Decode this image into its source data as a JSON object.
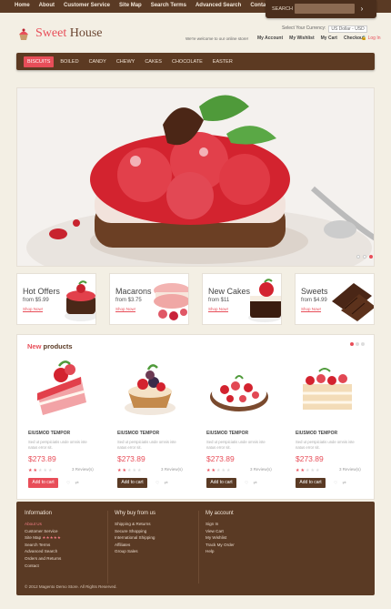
{
  "topnav": [
    "Home",
    "About",
    "Customer Service",
    "Site Map",
    "Search Terms",
    "Advanced Search",
    "Contacts"
  ],
  "search": {
    "label": "SEARCH",
    "placeholder": ""
  },
  "logo": {
    "word1": "Sweet",
    "word2": "House"
  },
  "currency": {
    "label": "Select Your Currency:",
    "value": "US Dollar - USD"
  },
  "welcome": "We're welcome to our online store!",
  "account_links": [
    "My Account",
    "My Wishlist",
    "My Cart",
    "Checkout"
  ],
  "login": "Log In",
  "menu": [
    "BISCUITS",
    "BOILED",
    "CANDY",
    "CHEWY",
    "CAKES",
    "CHOCOLATE",
    "EASTER"
  ],
  "hero": {
    "slides": 3,
    "active": 0
  },
  "banners": [
    {
      "title": "Hot Offers",
      "price": "from $5.99",
      "link": "Shop Now!"
    },
    {
      "title": "Macarons",
      "price": "from $3.75",
      "link": "Shop Now!"
    },
    {
      "title": "New Cakes",
      "price": "from $11",
      "link": "Shop Now!"
    },
    {
      "title": "Sweets",
      "price": "from $4.99",
      "link": "Shop Now!"
    }
  ],
  "new_products": {
    "title_accent": "New",
    "title_rest": " products",
    "items": [
      {
        "name": "EIUSMOD TEMPOR",
        "desc": "Sed ut perspiciatis unde omnis iste natus error sit.",
        "price": "$273.89",
        "reviews": "3 Review(s)",
        "button": "Add to cart",
        "rating": 2
      },
      {
        "name": "EIUSMOD TEMPOR",
        "desc": "Sed ut perspiciatis unde omnis iste natus error sit.",
        "price": "$273.89",
        "reviews": "3 Review(s)",
        "button": "Add to cart",
        "rating": 2
      },
      {
        "name": "EIUSMOD TEMPOR",
        "desc": "Sed ut perspiciatis unde omnis iste natus error sit.",
        "price": "$273.89",
        "reviews": "3 Review(s)",
        "button": "Add to cart",
        "rating": 2
      },
      {
        "name": "EIUSMOD TEMPOR",
        "desc": "Sed ut perspiciatis unde omnis iste natus error sit.",
        "price": "$273.89",
        "reviews": "3 Review(s)",
        "button": "Add to cart",
        "rating": 2
      }
    ]
  },
  "footer": {
    "col1": {
      "title": "Information",
      "links": [
        "About Us",
        "Customer Service",
        "Site Map",
        "Search Terms",
        "Advanced Search",
        "Orders and Returns",
        "Contact"
      ]
    },
    "col2": {
      "title": "Why buy from us",
      "links": [
        "Shipping & Returns",
        "Secure Shopping",
        "International Shipping",
        "Affiliates",
        "Group Sales"
      ]
    },
    "col3": {
      "title": "My account",
      "links": [
        "Sign In",
        "View Cart",
        "My Wishlist",
        "Track My Order",
        "Help"
      ]
    },
    "copyright": "© 2012 Magento Demo Store. All Rights Reserved."
  },
  "colors": {
    "accent": "#e84e59",
    "brown": "#5a3a24",
    "bg": "#f3efe4"
  }
}
